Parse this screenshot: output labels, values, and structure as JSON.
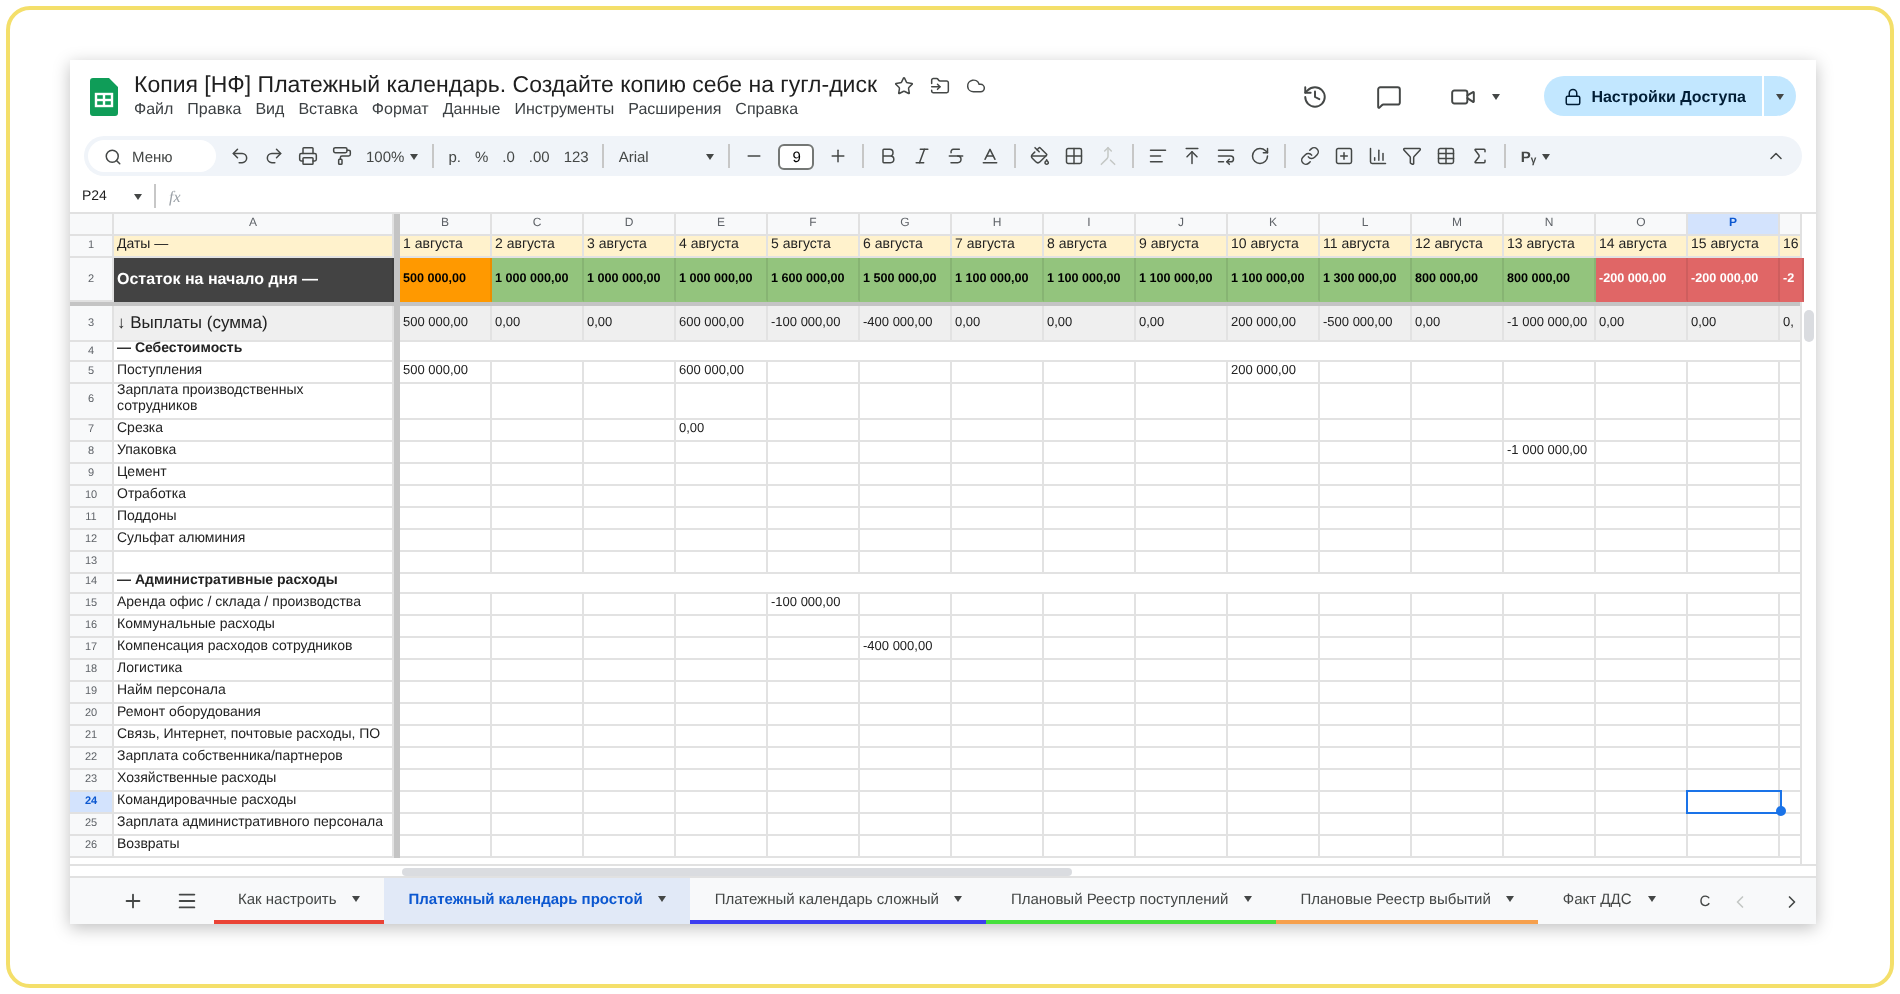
{
  "document": {
    "title": "Копия [НФ] Платежный календарь. Создайте копию себе на гугл-диск"
  },
  "menu": [
    "Файл",
    "Правка",
    "Вид",
    "Вставка",
    "Формат",
    "Данные",
    "Инструменты",
    "Расширения",
    "Справка"
  ],
  "share_button": "Настройки Доступа",
  "toolbar": {
    "search": {
      "placeholder": "Меню"
    },
    "zoom": "100%",
    "currency": "р.",
    "percent": "%",
    "decrease_decimals": ".0",
    "increase_decimals": ".00",
    "number_format": "123",
    "font": "Arial",
    "font_size": "9",
    "input_tools": "Pᵧ"
  },
  "formula_bar": {
    "cell_ref": "P24",
    "fx": "fx"
  },
  "columns": [
    {
      "letter": "A",
      "selected": false
    },
    {
      "letter": "B",
      "selected": false
    },
    {
      "letter": "C",
      "selected": false
    },
    {
      "letter": "D",
      "selected": false
    },
    {
      "letter": "E",
      "selected": false
    },
    {
      "letter": "F",
      "selected": false
    },
    {
      "letter": "G",
      "selected": false
    },
    {
      "letter": "H",
      "selected": false
    },
    {
      "letter": "I",
      "selected": false
    },
    {
      "letter": "J",
      "selected": false
    },
    {
      "letter": "K",
      "selected": false
    },
    {
      "letter": "L",
      "selected": false
    },
    {
      "letter": "M",
      "selected": false
    },
    {
      "letter": "N",
      "selected": false
    },
    {
      "letter": "O",
      "selected": false
    },
    {
      "letter": "P",
      "selected": true
    }
  ],
  "rows": [
    {
      "number": "1",
      "selected": false,
      "kind": "dates",
      "label": "Даты —",
      "cells": [
        "1 августа",
        "2 августа",
        "3 августа",
        "4 августа",
        "5 августа",
        "6 августа",
        "7 августа",
        "8 августа",
        "9 августа",
        "10 августа",
        "11 августа",
        "12 августа",
        "13 августа",
        "14 августа",
        "15 августа",
        "16"
      ]
    },
    {
      "number": "2",
      "selected": false,
      "kind": "balance",
      "label": "Остаток на начало дня —",
      "cells": [
        {
          "text": "500 000,00",
          "color": "#ff9900"
        },
        {
          "text": "1 000 000,00",
          "color": "#93c47d"
        },
        {
          "text": "1 000 000,00",
          "color": "#93c47d"
        },
        {
          "text": "1 000 000,00",
          "color": "#93c47d"
        },
        {
          "text": "1 600 000,00",
          "color": "#93c47d"
        },
        {
          "text": "1 500 000,00",
          "color": "#93c47d"
        },
        {
          "text": "1 100 000,00",
          "color": "#93c47d"
        },
        {
          "text": "1 100 000,00",
          "color": "#93c47d"
        },
        {
          "text": "1 100 000,00",
          "color": "#93c47d"
        },
        {
          "text": "1 100 000,00",
          "color": "#93c47d"
        },
        {
          "text": "1 300 000,00",
          "color": "#93c47d"
        },
        {
          "text": "800 000,00",
          "color": "#93c47d"
        },
        {
          "text": "800 000,00",
          "color": "#93c47d"
        },
        {
          "text": "-200 000,00",
          "color": "#e06666"
        },
        {
          "text": "-200 000,00",
          "color": "#e06666"
        },
        {
          "text": "-2",
          "color": "#e06666"
        }
      ]
    },
    {
      "number": "3",
      "selected": false,
      "kind": "total",
      "label": "↓ Выплаты (сумма)",
      "cells": [
        "500 000,00",
        "0,00",
        "0,00",
        "600 000,00",
        "-100 000,00",
        "-400 000,00",
        "0,00",
        "0,00",
        "0,00",
        "200 000,00",
        "-500 000,00",
        "0,00",
        "-1 000 000,00",
        "0,00",
        "0,00",
        "0,"
      ]
    },
    {
      "number": "4",
      "selected": false,
      "kind": "section",
      "label": "— Себестоимость"
    },
    {
      "number": "5",
      "selected": false,
      "kind": "item",
      "label": "Поступления",
      "cells": [
        "500 000,00",
        null,
        null,
        "600 000,00",
        null,
        null,
        null,
        null,
        null,
        "200 000,00",
        null,
        null,
        null,
        null,
        null,
        null
      ]
    },
    {
      "number": "6",
      "selected": false,
      "kind": "item",
      "label": "Зарплата производственных\nсотрудников"
    },
    {
      "number": "7",
      "selected": false,
      "kind": "item",
      "label": "Срезка",
      "cells": [
        null,
        null,
        null,
        "0,00",
        null,
        null,
        null,
        null,
        null,
        null,
        null,
        null,
        null,
        null,
        null,
        null
      ]
    },
    {
      "number": "8",
      "selected": false,
      "kind": "item",
      "label": "Упаковка",
      "cells": [
        null,
        null,
        null,
        null,
        null,
        null,
        null,
        null,
        null,
        null,
        null,
        null,
        "-1 000 000,00",
        null,
        null,
        null
      ]
    },
    {
      "number": "9",
      "selected": false,
      "kind": "item",
      "label": "Цемент"
    },
    {
      "number": "10",
      "selected": false,
      "kind": "item",
      "label": "Отработка"
    },
    {
      "number": "11",
      "selected": false,
      "kind": "item",
      "label": "Поддоны"
    },
    {
      "number": "12",
      "selected": false,
      "kind": "item",
      "label": "Сульфат алюминия"
    },
    {
      "number": "13",
      "selected": false,
      "kind": "item"
    },
    {
      "number": "14",
      "selected": false,
      "kind": "section",
      "label": "— Административные расходы"
    },
    {
      "number": "15",
      "selected": false,
      "kind": "item",
      "label": "Аренда офис / склада / производства",
      "cells": [
        null,
        null,
        null,
        null,
        "-100 000,00",
        null,
        null,
        null,
        null,
        null,
        null,
        null,
        null,
        null,
        null,
        null
      ]
    },
    {
      "number": "16",
      "selected": false,
      "kind": "item",
      "label": "Коммунальные расходы"
    },
    {
      "number": "17",
      "selected": false,
      "kind": "item",
      "label": "Компенсация расходов сотрудников",
      "cells": [
        null,
        null,
        null,
        null,
        null,
        "-400 000,00",
        null,
        null,
        null,
        null,
        null,
        null,
        null,
        null,
        null,
        null
      ]
    },
    {
      "number": "18",
      "selected": false,
      "kind": "item",
      "label": "Логистика"
    },
    {
      "number": "19",
      "selected": false,
      "kind": "item",
      "label": "Найм персонала"
    },
    {
      "number": "20",
      "selected": false,
      "kind": "item",
      "label": "Ремонт оборудования"
    },
    {
      "number": "21",
      "selected": false,
      "kind": "item",
      "label": "Связь, Интернет, почтовые расходы, ПО"
    },
    {
      "number": "22",
      "selected": false,
      "kind": "item",
      "label": "Зарплата собственника/партнеров"
    },
    {
      "number": "23",
      "selected": false,
      "kind": "item",
      "label": "Хозяйственные расходы"
    },
    {
      "number": "24",
      "selected": true,
      "kind": "item",
      "label": "Командировачные расходы"
    },
    {
      "number": "25",
      "selected": false,
      "kind": "item",
      "label": "Зарплата административного персонала"
    },
    {
      "number": "26",
      "selected": false,
      "kind": "item",
      "label": "Возвраты"
    }
  ],
  "sheet_tabs": [
    {
      "label": "Как настроить",
      "selected": false,
      "color": "#ea4335"
    },
    {
      "label": "Платежный календарь простой",
      "selected": true
    },
    {
      "label": "Платежный календарь сложный",
      "selected": false,
      "color": "#3d3df0"
    },
    {
      "label": "Плановый Реестр поступлений",
      "selected": false,
      "color": "#45e03c"
    },
    {
      "label": "Плановые Реестр выбытий",
      "selected": false,
      "color": "#f6a04d"
    },
    {
      "label": "Факт ДДС",
      "selected": false
    },
    {
      "label": "С",
      "selected": false,
      "partial": true
    }
  ]
}
